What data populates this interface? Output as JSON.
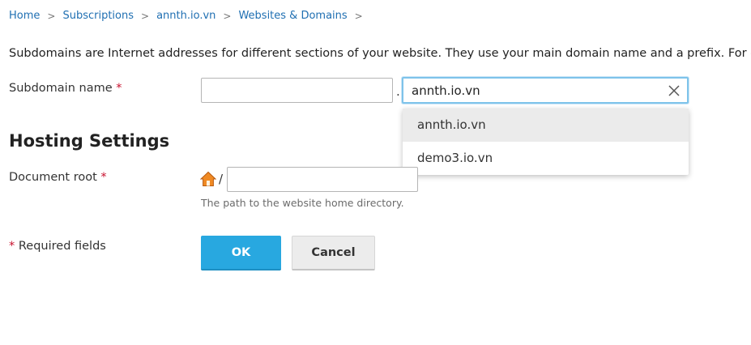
{
  "breadcrumb": {
    "items": [
      "Home",
      "Subscriptions",
      "annth.io.vn",
      "Websites & Domains"
    ],
    "separator": ">"
  },
  "intro_text": "Subdomains are Internet addresses for different sections of your website. They use your main domain name and a prefix. For ex",
  "form": {
    "subdomain_label": "Subdomain name",
    "required_mark": "*",
    "subdomain_value": "",
    "dot": ".",
    "domain_selected": "annth.io.vn",
    "domain_options": [
      "annth.io.vn",
      "demo3.io.vn"
    ],
    "hosting_title": "Hosting Settings",
    "docroot_label": "Document root",
    "docroot_slash": "/",
    "docroot_value": "",
    "docroot_hint": "The path to the website home directory.",
    "required_fields": "Required fields"
  },
  "buttons": {
    "ok": "OK",
    "cancel": "Cancel"
  },
  "colors": {
    "link": "#1f6fb2",
    "primary": "#28a8e0",
    "required": "#c8102e",
    "focus": "#7ec3ea"
  },
  "icons": {
    "clear": "close-icon",
    "home": "home-icon",
    "chevron": "chevron-right-icon"
  }
}
